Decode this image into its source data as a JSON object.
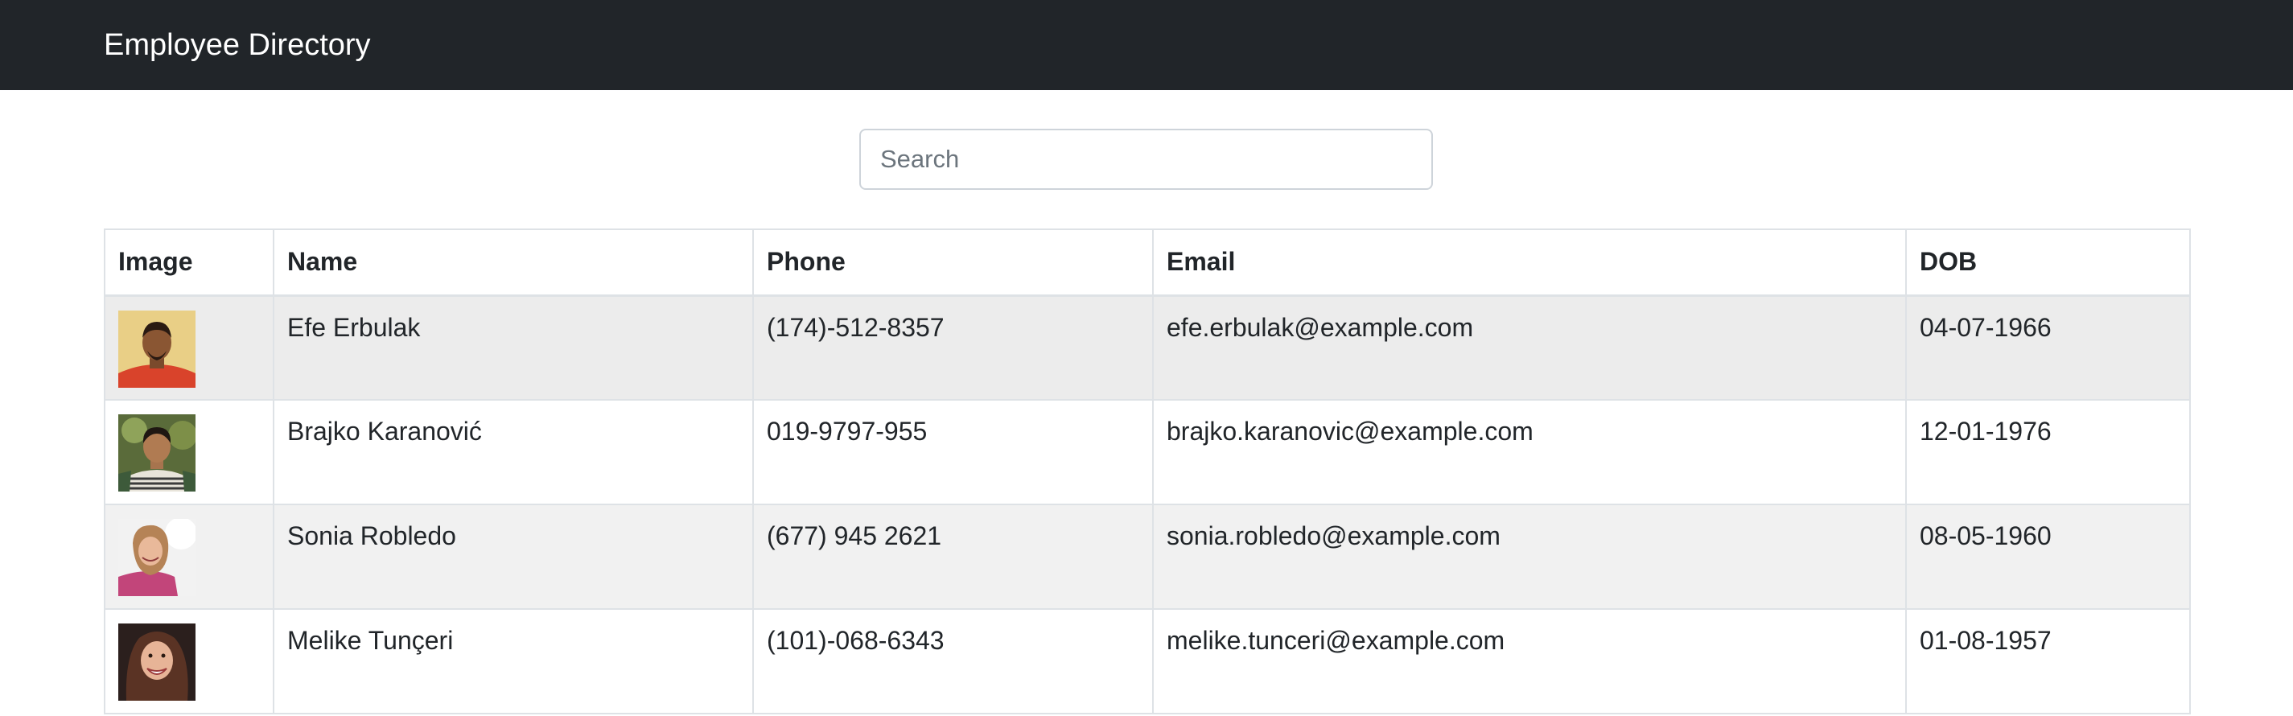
{
  "navbar": {
    "brand": "Employee Directory"
  },
  "search": {
    "placeholder": "Search",
    "value": ""
  },
  "table": {
    "headers": {
      "image": "Image",
      "name": "Name",
      "phone": "Phone",
      "email": "Email",
      "dob": "DOB"
    },
    "rows": [
      {
        "name": "Efe Erbulak",
        "phone": "(174)-512-8357",
        "email": "efe.erbulak@example.com",
        "dob": "04-07-1966"
      },
      {
        "name": "Brajko Karanović",
        "phone": "019-9797-955",
        "email": "brajko.karanovic@example.com",
        "dob": "12-01-1976"
      },
      {
        "name": "Sonia Robledo",
        "phone": "(677) 945 2621",
        "email": "sonia.robledo@example.com",
        "dob": "08-05-1960"
      },
      {
        "name": "Melike Tunçeri",
        "phone": "(101)-068-6343",
        "email": "melike.tunceri@example.com",
        "dob": "01-08-1957"
      }
    ]
  },
  "colors": {
    "navbar_bg": "#212529",
    "row_stripe": "#ececec",
    "border": "#dee2e6"
  }
}
